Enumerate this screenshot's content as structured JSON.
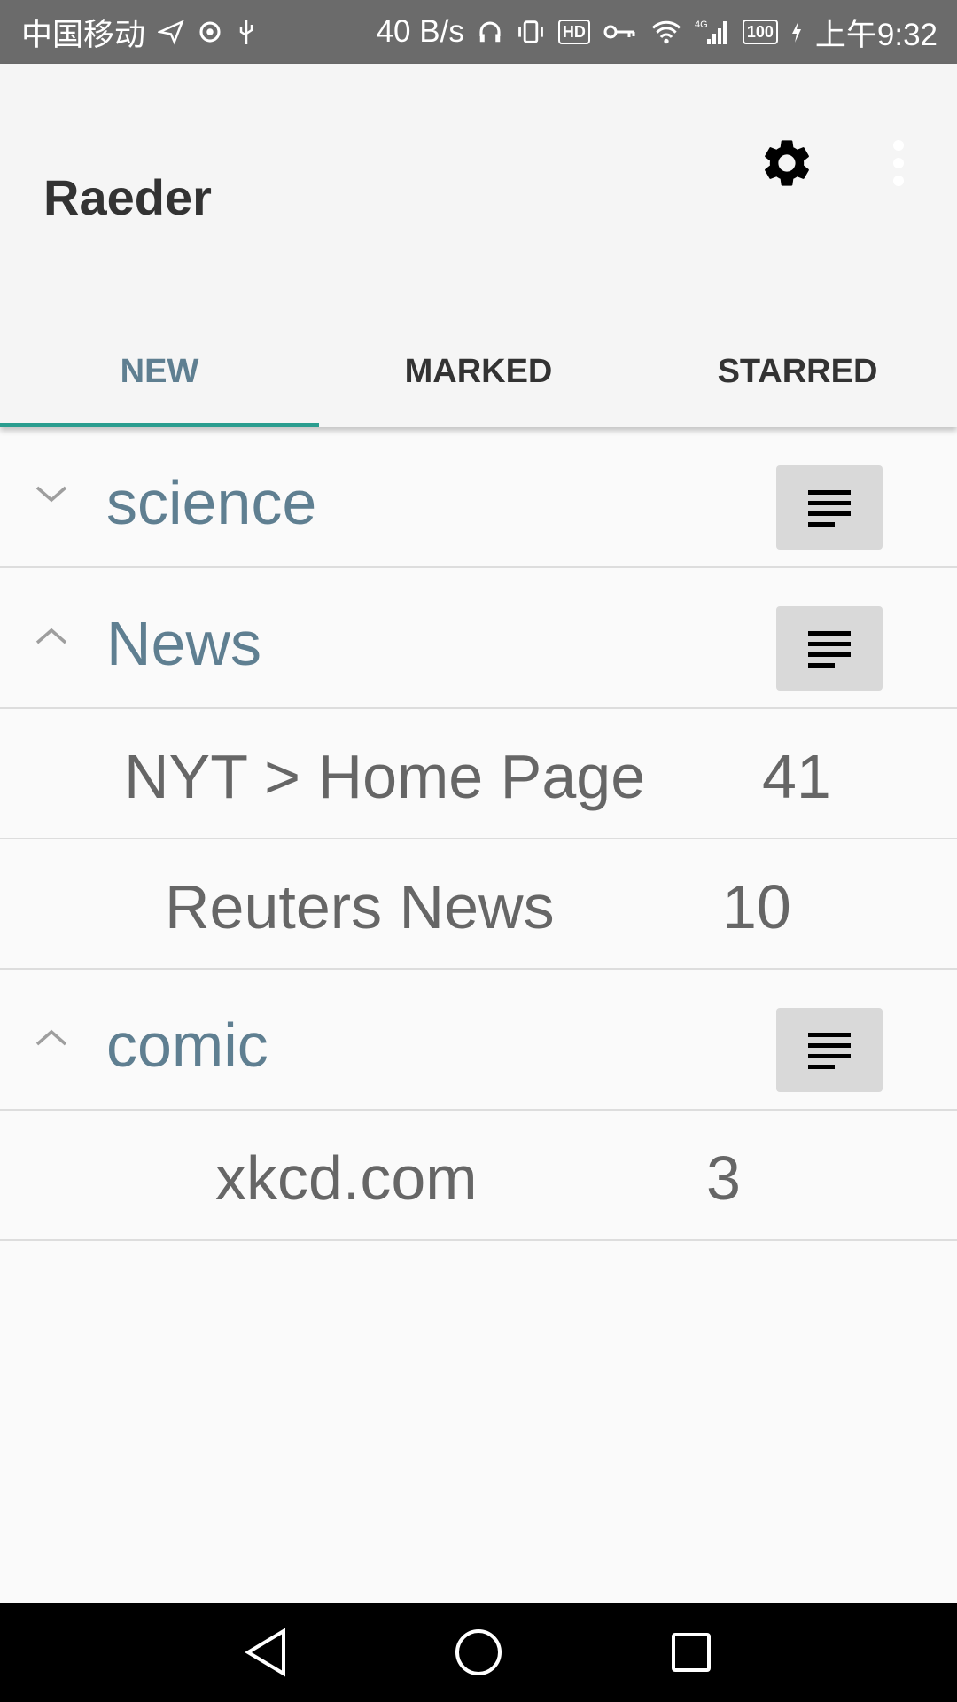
{
  "status_bar": {
    "carrier": "中国移动",
    "net_speed": "40 B/s",
    "signal_type": "4G",
    "battery": "100",
    "hd_label": "HD",
    "time": "上午9:32"
  },
  "app_bar": {
    "title": "Raeder",
    "icons": [
      "gear-icon",
      "more-vert-icon"
    ]
  },
  "tabs": [
    {
      "label": "NEW",
      "active": true
    },
    {
      "label": "MARKED",
      "active": false
    },
    {
      "label": "STARRED",
      "active": false
    }
  ],
  "groups": [
    {
      "name": "science",
      "expanded": false,
      "feeds": []
    },
    {
      "name": "News",
      "expanded": true,
      "feeds": [
        {
          "name": "NYT > Home Page",
          "count": "41"
        },
        {
          "name": "Reuters News",
          "count": "10"
        }
      ]
    },
    {
      "name": "comic",
      "expanded": true,
      "feeds": [
        {
          "name": "xkcd.com",
          "count": "3"
        }
      ]
    }
  ],
  "colors": {
    "accent": "#2a9d8f",
    "group_text": "#5f7f91",
    "feed_text": "#666666"
  }
}
